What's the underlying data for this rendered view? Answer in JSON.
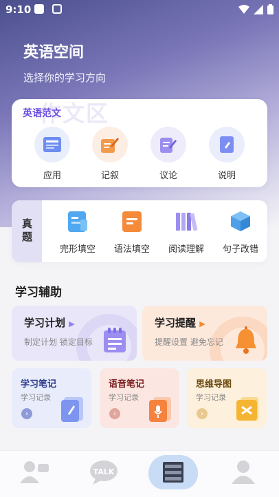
{
  "status": {
    "time": "9:10"
  },
  "header": {
    "title": "英语空间",
    "subtitle": "选择你的学习方向"
  },
  "essay_card": {
    "title": "英语范文",
    "watermark": "作文区",
    "items": [
      {
        "label": "应用",
        "icon": "application-doc-icon"
      },
      {
        "label": "记叙",
        "icon": "narrative-edit-icon"
      },
      {
        "label": "议论",
        "icon": "argument-doc-icon"
      },
      {
        "label": "说明",
        "icon": "exposition-doc-icon"
      }
    ]
  },
  "exam_card": {
    "tag": "真题",
    "items": [
      {
        "label": "完形填空",
        "icon": "cloze-icon"
      },
      {
        "label": "语法填空",
        "icon": "grammar-fill-icon"
      },
      {
        "label": "阅读理解",
        "icon": "reading-books-icon"
      },
      {
        "label": "句子改错",
        "icon": "sentence-cube-icon"
      }
    ]
  },
  "assist": {
    "section_title": "学习辅助",
    "plan": {
      "title": "学习计划",
      "desc": "制定计划 锁定目标"
    },
    "reminder": {
      "title": "学习提醒",
      "desc": "提醒设置 避免忘记"
    },
    "notes": [
      {
        "title": "学习笔记",
        "desc": "学习记录",
        "color": "#2b3a8a"
      },
      {
        "title": "语音笔记",
        "desc": "学习记录",
        "color": "#7a1f1f"
      },
      {
        "title": "思维导图",
        "desc": "学习记录",
        "color": "#6b4a10"
      }
    ]
  },
  "tabbar": {
    "items": [
      {
        "name": "friends-tab",
        "icon": "people-icon"
      },
      {
        "name": "talk-tab",
        "icon": "talk-bubble-icon",
        "label": "TALK"
      },
      {
        "name": "library-tab",
        "icon": "bookshelf-icon",
        "active": true
      },
      {
        "name": "profile-tab",
        "icon": "person-icon"
      }
    ]
  }
}
